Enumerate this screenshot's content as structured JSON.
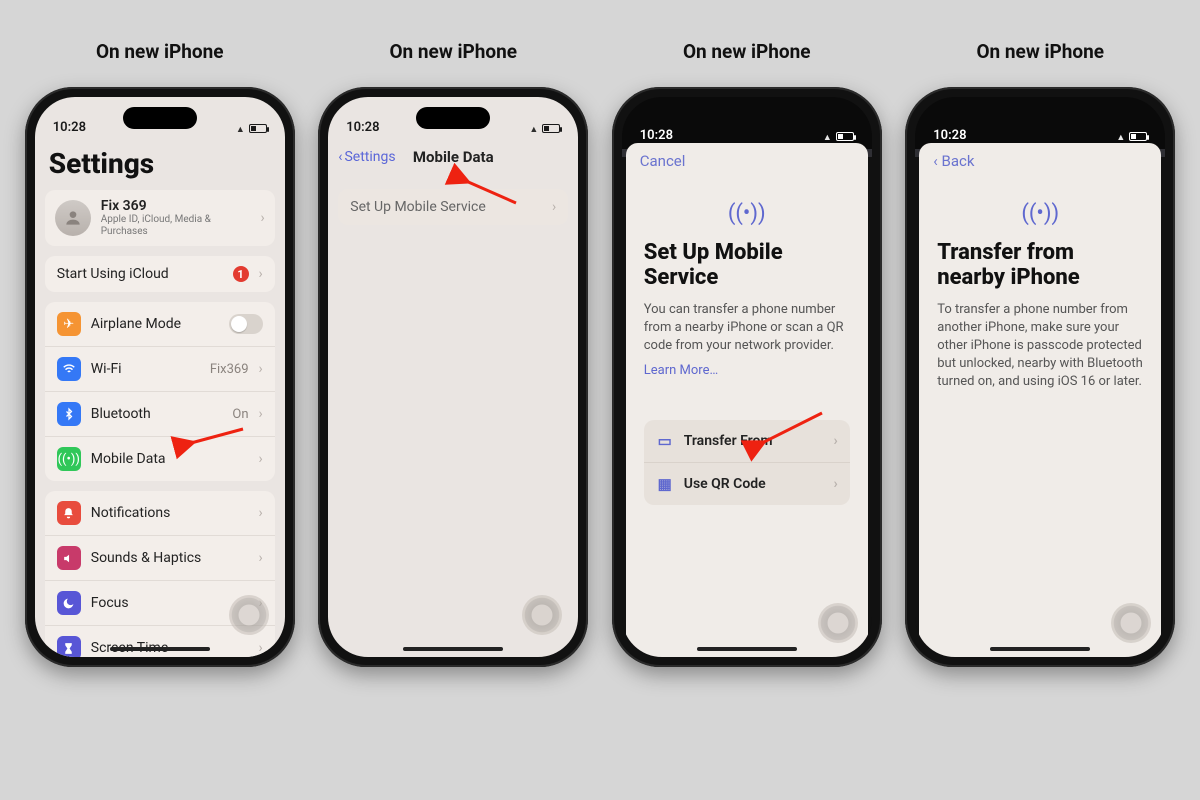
{
  "captions": [
    "On new iPhone",
    "On new iPhone",
    "On new iPhone",
    "On new iPhone"
  ],
  "status": {
    "time": "10:28"
  },
  "phone1": {
    "title": "Settings",
    "profile": {
      "name": "Fix 369",
      "sub": "Apple ID, iCloud, Media & Purchases"
    },
    "icloud_row": {
      "label": "Start Using iCloud",
      "badge": "1"
    },
    "rows_net": [
      {
        "label": "Airplane Mode",
        "icon": "airplane-icon",
        "color": "#f59433",
        "value": "",
        "toggle": true
      },
      {
        "label": "Wi-Fi",
        "icon": "wifi-icon",
        "color": "#3478f6",
        "value": "Fix369"
      },
      {
        "label": "Bluetooth",
        "icon": "bluetooth-icon",
        "color": "#3478f6",
        "value": "On"
      },
      {
        "label": "Mobile Data",
        "icon": "antenna-icon",
        "color": "#30c759",
        "value": ""
      }
    ],
    "rows_sys": [
      {
        "label": "Notifications",
        "icon": "bell-icon",
        "color": "#e84c3d"
      },
      {
        "label": "Sounds & Haptics",
        "icon": "speaker-icon",
        "color": "#c83a6a"
      },
      {
        "label": "Focus",
        "icon": "moon-icon",
        "color": "#5856d6"
      },
      {
        "label": "Screen Time",
        "icon": "hourglass-icon",
        "color": "#5856d6"
      }
    ]
  },
  "phone2": {
    "back": "Settings",
    "title": "Mobile Data",
    "row": "Set Up Mobile Service"
  },
  "phone3": {
    "cancel": "Cancel",
    "heading": "Set Up Mobile Service",
    "body": "You can transfer a phone number from a nearby iPhone or scan a QR code from your network provider.",
    "learn": "Learn More…",
    "opt1": "Transfer From",
    "opt2": "Use QR Code"
  },
  "phone4": {
    "back": "Back",
    "heading": "Transfer from nearby iPhone",
    "body": "To transfer a phone number from another iPhone, make sure your other iPhone is passcode protected but unlocked, nearby with Bluetooth turned on, and using iOS 16 or later."
  }
}
